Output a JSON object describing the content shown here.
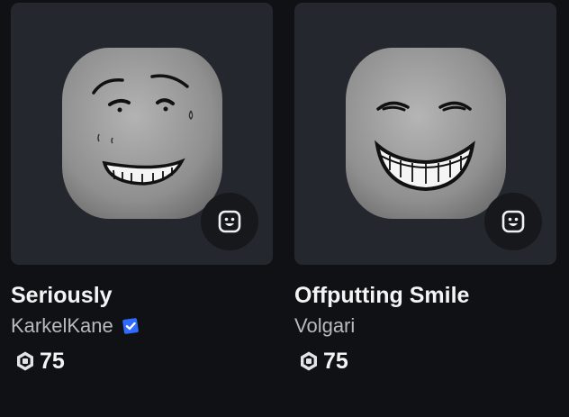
{
  "items": [
    {
      "title": "Seriously",
      "creator": "KarkelKane",
      "creator_verified": true,
      "price": "75",
      "thumbnail_icon": "seriously-face",
      "action_icon": "emote-face-icon"
    },
    {
      "title": "Offputting Smile",
      "creator": "Volgari",
      "creator_verified": false,
      "price": "75",
      "thumbnail_icon": "offputting-smile-face",
      "action_icon": "emote-face-icon"
    }
  ],
  "colors": {
    "background": "#101115",
    "card_background": "#25272e",
    "title_text": "#f4f4f5",
    "creator_text": "#b8bac0",
    "verified_badge": "#2f6bff"
  }
}
